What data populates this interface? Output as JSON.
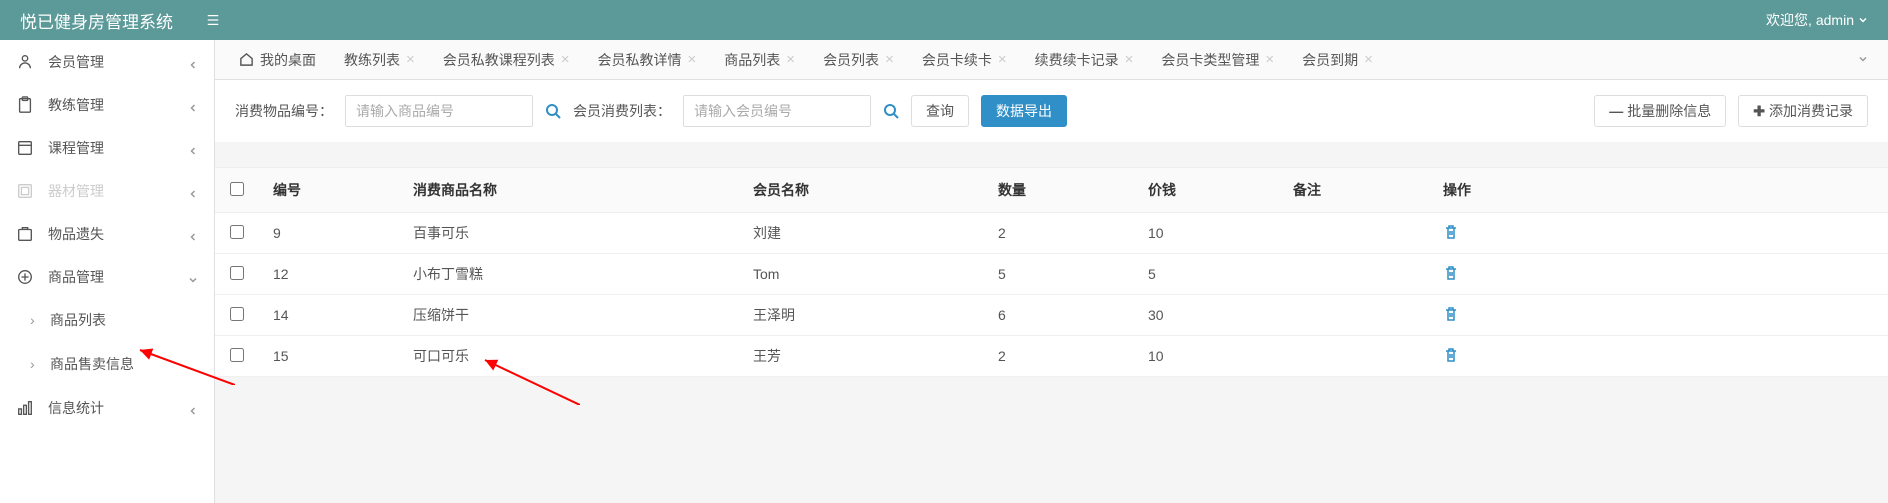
{
  "header": {
    "title": "悦已健身房管理系统",
    "welcome": "欢迎您,",
    "username": "admin"
  },
  "sidebar": {
    "items": [
      {
        "label": "会员管理",
        "expanded": false
      },
      {
        "label": "教练管理",
        "expanded": false
      },
      {
        "label": "课程管理",
        "expanded": false
      },
      {
        "label": "器材管理",
        "expanded": false,
        "disabled": true
      },
      {
        "label": "物品遗失",
        "expanded": false
      },
      {
        "label": "商品管理",
        "expanded": true
      },
      {
        "label": "信息统计",
        "expanded": false
      }
    ],
    "sub": [
      {
        "label": "商品列表"
      },
      {
        "label": "商品售卖信息"
      }
    ]
  },
  "tabs": [
    {
      "label": "我的桌面",
      "home": true
    },
    {
      "label": "教练列表"
    },
    {
      "label": "会员私教课程列表"
    },
    {
      "label": "会员私教详情"
    },
    {
      "label": "商品列表"
    },
    {
      "label": "会员列表"
    },
    {
      "label": "会员卡续卡"
    },
    {
      "label": "续费续卡记录"
    },
    {
      "label": "会员卡类型管理"
    },
    {
      "label": "会员到期"
    }
  ],
  "toolbar": {
    "label1": "消费物品编号：",
    "placeholder1": "请输入商品编号",
    "label2": "会员消费列表：",
    "placeholder2": "请输入会员编号",
    "query_btn": "查询",
    "export_btn": "数据导出",
    "batch_delete_btn": "批量删除信息",
    "add_btn": "添加消费记录"
  },
  "table": {
    "headers": {
      "id": "编号",
      "product": "消费商品名称",
      "member": "会员名称",
      "qty": "数量",
      "price": "价钱",
      "note": "备注",
      "action": "操作"
    },
    "rows": [
      {
        "id": "9",
        "product": "百事可乐",
        "member": "刘建",
        "qty": "2",
        "price": "10",
        "note": ""
      },
      {
        "id": "12",
        "product": "小布丁雪糕",
        "member": "Tom",
        "qty": "5",
        "price": "5",
        "note": ""
      },
      {
        "id": "14",
        "product": "压缩饼干",
        "member": "王泽明",
        "qty": "6",
        "price": "30",
        "note": ""
      },
      {
        "id": "15",
        "product": "可口可乐",
        "member": "王芳",
        "qty": "2",
        "price": "10",
        "note": ""
      }
    ]
  }
}
